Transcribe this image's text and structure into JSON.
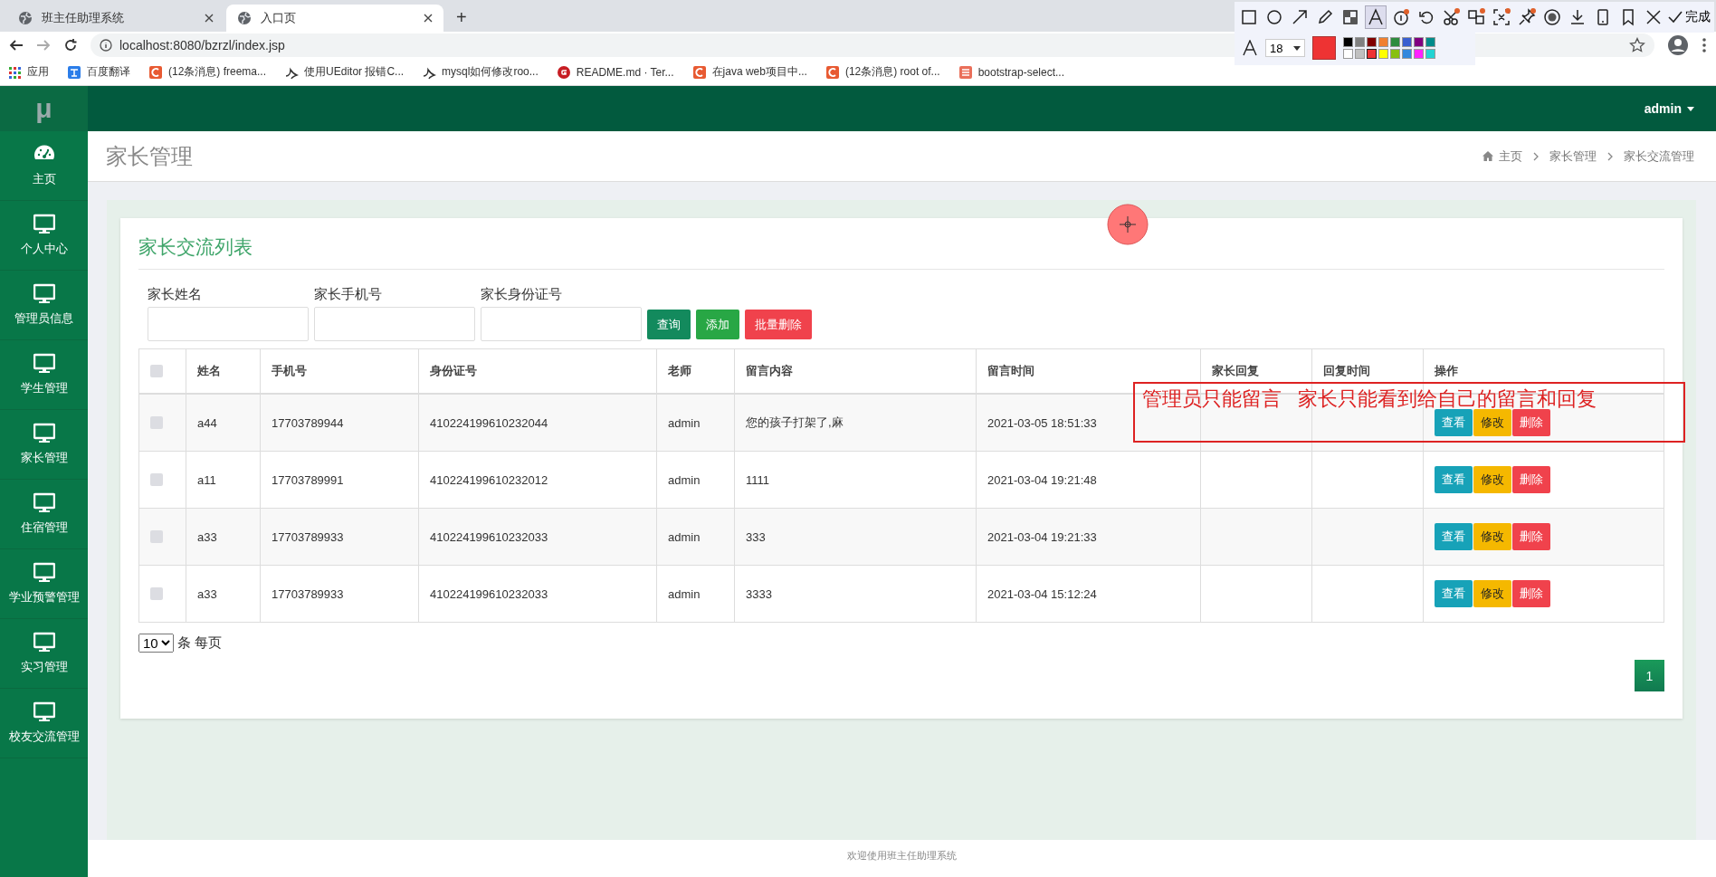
{
  "browser": {
    "tabs": [
      {
        "title": "班主任助理系统",
        "selected": false
      },
      {
        "title": "入口页",
        "selected": true
      }
    ],
    "new_tab": "+",
    "address": "localhost:8080/bzrzl/index.jsp",
    "bookmarks": [
      {
        "label": "应用",
        "kind": "apps"
      },
      {
        "label": "百度翻译",
        "kind": "translate"
      },
      {
        "label": "(12条消息) freema...",
        "kind": "csdn"
      },
      {
        "label": "使用UEditor 报错C...",
        "kind": "bird"
      },
      {
        "label": "mysql如何修改roo...",
        "kind": "bird"
      },
      {
        "label": "README.md · Ter...",
        "kind": "gitee"
      },
      {
        "label": "在java web项目中...",
        "kind": "csdn"
      },
      {
        "label": "(12条消息) root of...",
        "kind": "csdn"
      },
      {
        "label": "bootstrap-select...",
        "kind": "jian"
      }
    ]
  },
  "screenshot_toolbar": {
    "tools": [
      {
        "kind": "rect",
        "selected": false
      },
      {
        "kind": "ellipse",
        "selected": false
      },
      {
        "kind": "arrow",
        "selected": false
      },
      {
        "kind": "pencil",
        "selected": false
      },
      {
        "kind": "mosaic",
        "selected": false
      },
      {
        "kind": "text",
        "selected": true
      },
      {
        "kind": "number",
        "selected": false
      },
      {
        "kind": "undo",
        "selected": false
      },
      {
        "kind": "scissors",
        "selected": false
      },
      {
        "kind": "translate",
        "selected": false
      },
      {
        "kind": "ocr",
        "selected": false
      },
      {
        "kind": "pin",
        "selected": false
      },
      {
        "kind": "record",
        "selected": false
      },
      {
        "kind": "download",
        "selected": false
      },
      {
        "kind": "phone",
        "selected": false
      },
      {
        "kind": "bookmark",
        "selected": false
      },
      {
        "kind": "close",
        "selected": false
      }
    ],
    "done": "完成",
    "font_size": "18",
    "swatches": [
      {
        "color": "#000000",
        "selected": false
      },
      {
        "color": "#808080",
        "selected": false
      },
      {
        "color": "#800000",
        "selected": false
      },
      {
        "color": "#f08030",
        "selected": false
      },
      {
        "color": "#2e8b3e",
        "selected": false
      },
      {
        "color": "#3a5fd0",
        "selected": false
      },
      {
        "color": "#800080",
        "selected": false
      },
      {
        "color": "#008b8b",
        "selected": false
      },
      {
        "color": "#ffffff",
        "selected": false
      },
      {
        "color": "#c0c0c0",
        "selected": false
      },
      {
        "color": "#ee3333",
        "selected": true
      },
      {
        "color": "#ffff00",
        "selected": false
      },
      {
        "color": "#88c010",
        "selected": false
      },
      {
        "color": "#3388dd",
        "selected": false
      },
      {
        "color": "#ff22ff",
        "selected": false
      },
      {
        "color": "#22d3d3",
        "selected": false
      }
    ]
  },
  "app": {
    "logo": "μ",
    "user": "admin",
    "sidebar": [
      {
        "label": "主页",
        "kind": "dashboard"
      },
      {
        "label": "个人中心",
        "kind": "monitor"
      },
      {
        "label": "管理员信息",
        "kind": "monitor"
      },
      {
        "label": "学生管理",
        "kind": "monitor"
      },
      {
        "label": "家长管理",
        "kind": "monitor"
      },
      {
        "label": "住宿管理",
        "kind": "monitor"
      },
      {
        "label": "学业预警管理",
        "kind": "monitor"
      },
      {
        "label": "实习管理",
        "kind": "monitor"
      },
      {
        "label": "校友交流管理",
        "kind": "monitor"
      }
    ],
    "page_title": "家长管理",
    "breadcrumb": [
      "主页",
      "家长管理",
      "家长交流管理"
    ],
    "panel": {
      "title": "家长交流列表",
      "filters": [
        {
          "label": "家长姓名"
        },
        {
          "label": "家长手机号"
        },
        {
          "label": "家长身份证号"
        }
      ],
      "buttons": [
        {
          "label": "查询",
          "kind": "primary"
        },
        {
          "label": "添加",
          "kind": "success"
        },
        {
          "label": "批量删除",
          "kind": "danger"
        }
      ],
      "table": {
        "select_all": {
          "checked": false
        },
        "columns": [
          "姓名",
          "手机号",
          "身份证号",
          "老师",
          "留言内容",
          "留言时间",
          "家长回复",
          "回复时间",
          "操作"
        ],
        "rows": [
          {
            "checked": false,
            "cells": [
              "a44",
              "17703789944",
              "410224199610232044",
              "admin",
              "您的孩子打架了,麻",
              "2021-03-05 18:51:33",
              "",
              ""
            ],
            "actions": [
              {
                "label": "查看",
                "kind": "info"
              },
              {
                "label": "修改",
                "kind": "warning"
              },
              {
                "label": "删除",
                "kind": "danger"
              }
            ]
          },
          {
            "checked": false,
            "cells": [
              "a11",
              "17703789991",
              "410224199610232012",
              "admin",
              "1111",
              "2021-03-04 19:21:48",
              "",
              ""
            ],
            "actions": [
              {
                "label": "查看",
                "kind": "info"
              },
              {
                "label": "修改",
                "kind": "warning"
              },
              {
                "label": "删除",
                "kind": "danger"
              }
            ]
          },
          {
            "checked": false,
            "cells": [
              "a33",
              "17703789933",
              "410224199610232033",
              "admin",
              "333",
              "2021-03-04 19:21:33",
              "",
              ""
            ],
            "actions": [
              {
                "label": "查看",
                "kind": "info"
              },
              {
                "label": "修改",
                "kind": "warning"
              },
              {
                "label": "删除",
                "kind": "danger"
              }
            ]
          },
          {
            "checked": false,
            "cells": [
              "a33",
              "17703789933",
              "410224199610232033",
              "admin",
              "3333",
              "2021-03-04 15:12:24",
              "",
              ""
            ],
            "actions": [
              {
                "label": "查看",
                "kind": "info"
              },
              {
                "label": "修改",
                "kind": "warning"
              },
              {
                "label": "删除",
                "kind": "danger"
              }
            ]
          }
        ]
      },
      "page_size": "10",
      "page_size_suffix": "条 每页",
      "pages": [
        {
          "label": "1",
          "selected": true
        }
      ]
    },
    "footer": "欢迎使用班主任助理系统"
  },
  "annotation": {
    "text": "管理员只能留言   家长只能看到给自己的留言和回复",
    "color": "#dd2222"
  }
}
